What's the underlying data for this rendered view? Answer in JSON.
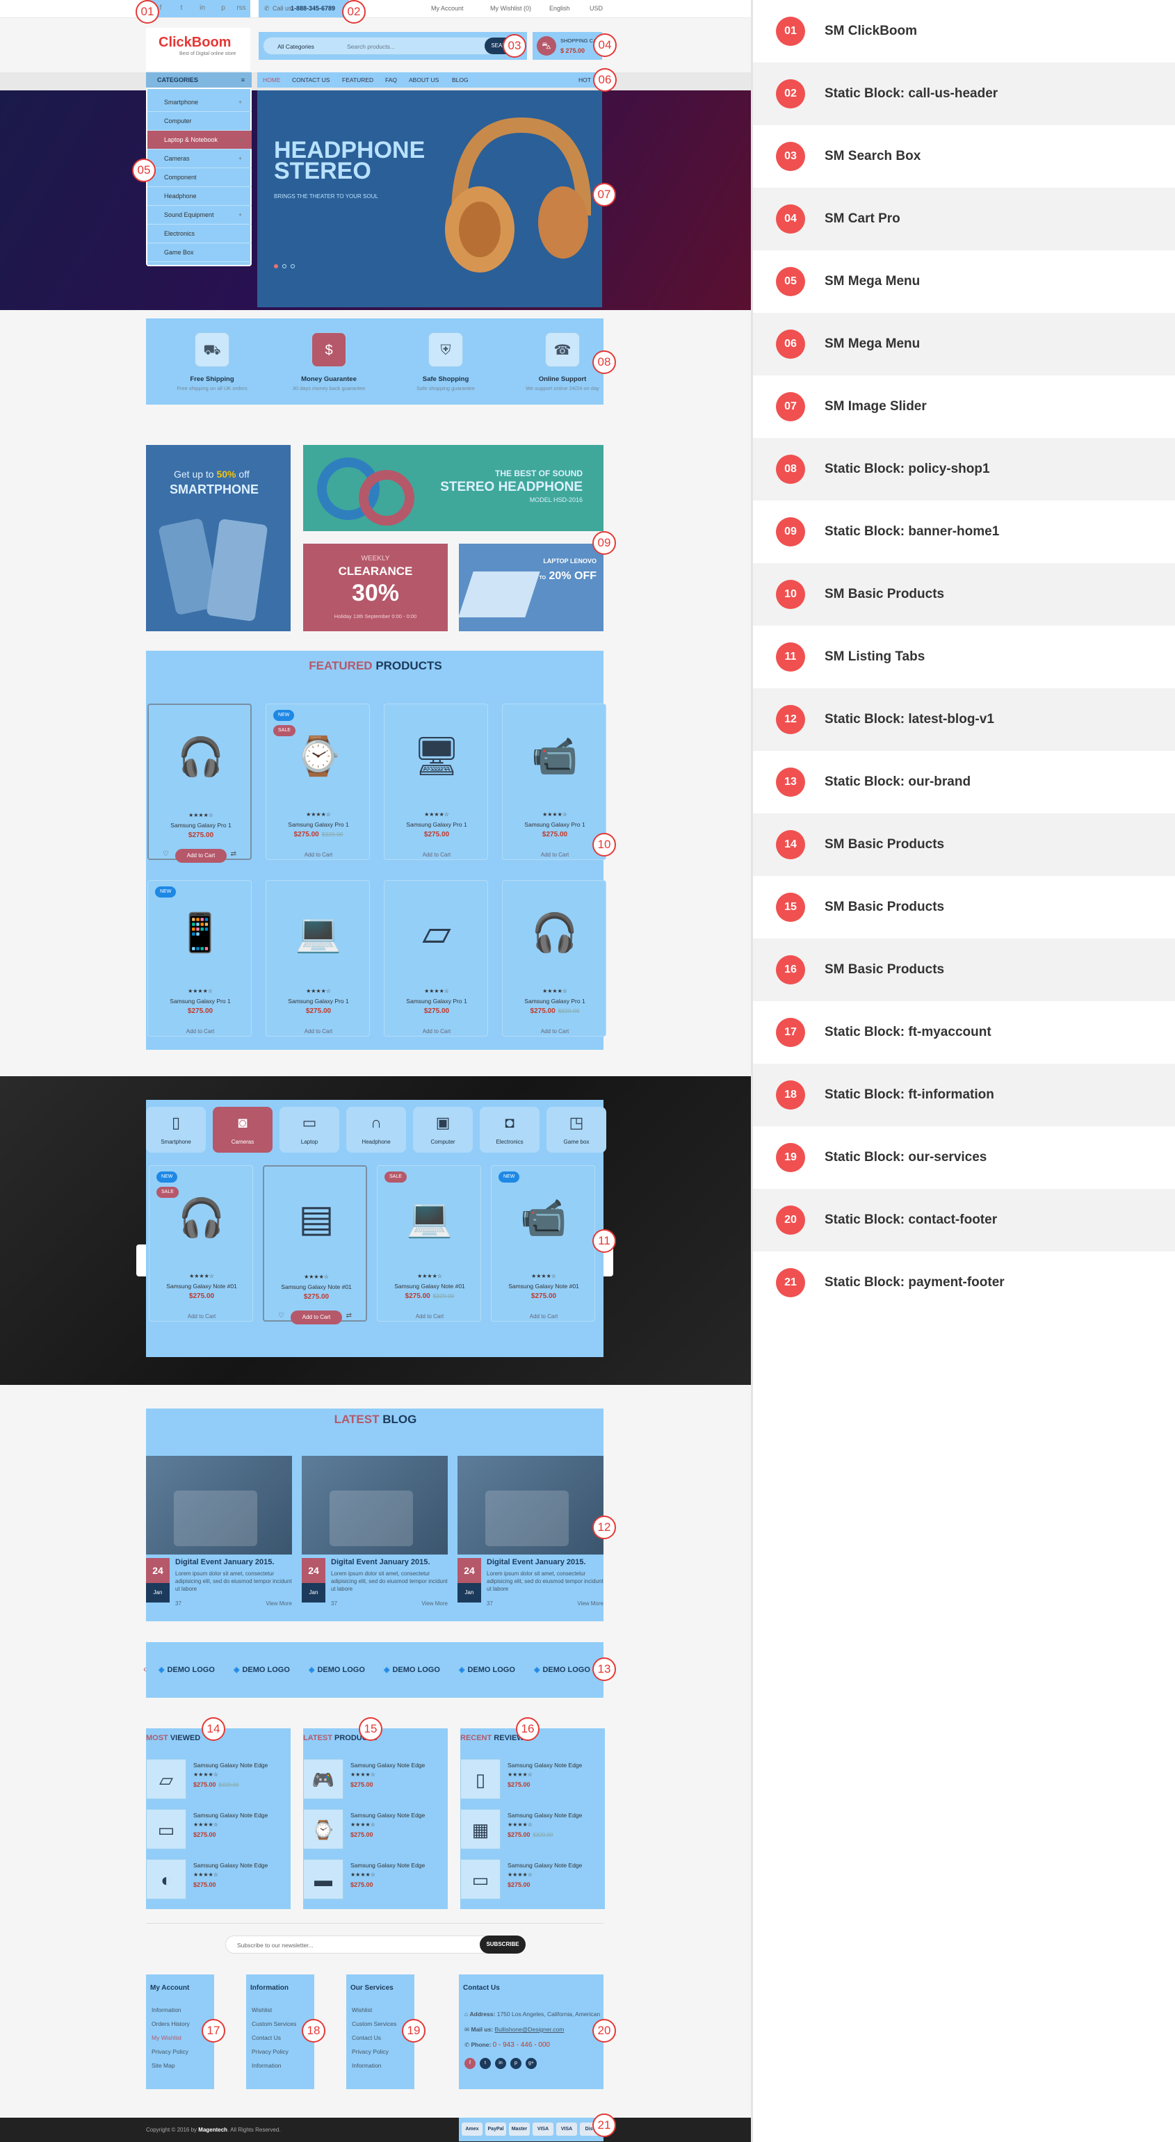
{
  "header": {
    "social_icons": [
      "f",
      "t",
      "in",
      "p",
      "rss"
    ],
    "call_label": "Call us:",
    "phone": "1-888-345-6789",
    "my_account": "My Account",
    "wishlist": "My Wishlist (0)",
    "language": "English",
    "currency": "USD",
    "logo_name": "ClickBoom",
    "logo_tagline": "Best of Digital online store",
    "search_category": "All Categories",
    "search_placeholder": "Search products...",
    "search_button": "SEARCH",
    "cart_label": "SHOPPING CART",
    "cart_total": "$ 275.00",
    "hot_label": "HOT"
  },
  "categories": {
    "title": "CATEGORIES",
    "items": [
      {
        "label": "Smartphone",
        "arrow": "+"
      },
      {
        "label": "Computer",
        "arrow": ""
      },
      {
        "label": "Laptop & Notebook",
        "arrow": "+"
      },
      {
        "label": "Cameras",
        "arrow": "+"
      },
      {
        "label": "Component",
        "arrow": ""
      },
      {
        "label": "Headphone",
        "arrow": ""
      },
      {
        "label": "Sound Equipment",
        "arrow": "+"
      },
      {
        "label": "Electronics",
        "arrow": ""
      },
      {
        "label": "Game Box",
        "arrow": ""
      }
    ]
  },
  "menu": [
    "HOME",
    "CONTACT US",
    "FEATURED",
    "FAQ",
    "ABOUT US",
    "BLOG"
  ],
  "slider": {
    "title_line1": "HEADPHONE",
    "title_line2": "STEREO",
    "subtitle": "BRINGS THE THEATER TO YOUR SOUL"
  },
  "policies": [
    {
      "title": "Free Shipping",
      "sub": "Free shipping on all UK orders",
      "icon": "⛟"
    },
    {
      "title": "Money Guarantee",
      "sub": "30 days money back guarantee",
      "icon": "$"
    },
    {
      "title": "Safe Shopping",
      "sub": "Safe shopping guarantee",
      "icon": "⛨"
    },
    {
      "title": "Online Support",
      "sub": "We support online 24/24 on day",
      "icon": "☎"
    }
  ],
  "banners": {
    "b1_line1": "Get up to",
    "b1_pct": "50%",
    "b1_off": "off",
    "b1_line2": "SMARTPHONE",
    "b2_line1": "THE BEST OF SOUND",
    "b2_line2": "STEREO HEADPHONE",
    "b2_line3": "MODEL HSD-2016",
    "b3_line1": "WEEKLY",
    "b3_line2": "CLEARANCE",
    "b3_pct": "30%",
    "b3_line3": "Holiday 13th September 0:00 - 0:00",
    "b4_line1": "LAPTOP LENOVO",
    "b4_up": "UP TO",
    "b4_pct": "20% OFF"
  },
  "featured": {
    "title_a": "FEATURED",
    "title_b": "PRODUCTS",
    "products": [
      {
        "name": "Samsung Galaxy Pro 1",
        "price": "$275.00",
        "old": "",
        "icon": "🎧",
        "tags": [],
        "btn": "Add to Cart",
        "active": true
      },
      {
        "name": "Samsung Galaxy Pro 1",
        "price": "$275.00",
        "old": "$329.00",
        "icon": "⌚",
        "tags": [
          "NEW",
          "SALE"
        ],
        "btn": "Add to Cart",
        "active": false
      },
      {
        "name": "Samsung Galaxy Pro 1",
        "price": "$275.00",
        "old": "",
        "icon": "🖥",
        "tags": [],
        "btn": "Add to Cart",
        "active": false
      },
      {
        "name": "Samsung Galaxy Pro 1",
        "price": "$275.00",
        "old": "",
        "icon": "📹",
        "tags": [],
        "btn": "Add to Cart",
        "active": false
      },
      {
        "name": "Samsung Galaxy Pro 1",
        "price": "$275.00",
        "old": "",
        "icon": "📱",
        "tags": [
          "NEW"
        ],
        "btn": "Add to Cart",
        "active": false
      },
      {
        "name": "Samsung Galaxy Pro 1",
        "price": "$275.00",
        "old": "",
        "icon": "💻",
        "tags": [],
        "btn": "Add to Cart",
        "active": false
      },
      {
        "name": "Samsung Galaxy Pro 1",
        "price": "$275.00",
        "old": "",
        "icon": "▱",
        "tags": [],
        "btn": "Add to Cart",
        "active": false
      },
      {
        "name": "Samsung Galaxy Pro 1",
        "price": "$275.00",
        "old": "$329.00",
        "icon": "🎧",
        "tags": [],
        "btn": "Add to Cart",
        "active": false
      }
    ]
  },
  "tabs": {
    "items": [
      {
        "label": "Smartphone",
        "icon": "▯"
      },
      {
        "label": "Cameras",
        "icon": "◙"
      },
      {
        "label": "Laptop",
        "icon": "▭"
      },
      {
        "label": "Headphone",
        "icon": "∩"
      },
      {
        "label": "Computer",
        "icon": "▣"
      },
      {
        "label": "Electronics",
        "icon": "◘"
      },
      {
        "label": "Game box",
        "icon": "◳"
      }
    ],
    "products": [
      {
        "name": "Samsung Galaxy Note #01",
        "price": "$275.00",
        "old": "",
        "icon": "🎧",
        "tags": [
          "NEW",
          "SALE"
        ],
        "btn": "Add to Cart",
        "active": false
      },
      {
        "name": "Samsung Galaxy Note #01",
        "price": "$275.00",
        "old": "",
        "icon": "▤",
        "tags": [],
        "btn": "Add to Cart",
        "active": true
      },
      {
        "name": "Samsung Galaxy Note #01",
        "price": "$275.00",
        "old": "$329.00",
        "icon": "💻",
        "tags": [
          "SALE"
        ],
        "btn": "Add to Cart",
        "active": false
      },
      {
        "name": "Samsung Galaxy Note #01",
        "price": "$275.00",
        "old": "",
        "icon": "📹",
        "tags": [
          "NEW"
        ],
        "btn": "Add to Cart",
        "active": false
      }
    ]
  },
  "blog": {
    "title_a": "LATEST",
    "title_b": "BLOG",
    "posts": [
      {
        "day": "24",
        "month": "Jan",
        "title": "Digital Event January 2015.",
        "excerpt": "Lorem ipsum dolor sit amet, consectetur adipisicing elit, sed do eiusmod tempor incidunt ut labore",
        "more": "View More",
        "count": "37"
      },
      {
        "day": "24",
        "month": "Jan",
        "title": "Digital Event January 2015.",
        "excerpt": "Lorem ipsum dolor sit amet, consectetur adipisicing elit, sed do eiusmod tempor incidunt ut labore",
        "more": "View More",
        "count": "37"
      },
      {
        "day": "24",
        "month": "Jan",
        "title": "Digital Event January 2015.",
        "excerpt": "Lorem ipsum dolor sit amet, consectetur adipisicing elit, sed do eiusmod tempor incidunt ut labore",
        "more": "View More",
        "count": "37"
      }
    ]
  },
  "brands": [
    "DEMO LOGO",
    "DEMO LOGO",
    "DEMO LOGO",
    "DEMO LOGO",
    "DEMO LOGO",
    "DEMO LOGO"
  ],
  "lists": [
    {
      "title_a": "MOST",
      "title_b": "VIEWED",
      "items": [
        {
          "name": "Samsung Galaxy Note Edge",
          "price": "$275.00",
          "old": "$329.00",
          "icon": "▱"
        },
        {
          "name": "Samsung Galaxy Note Edge",
          "price": "$275.00",
          "old": "",
          "icon": "▭"
        },
        {
          "name": "Samsung Galaxy Note Edge",
          "price": "$275.00",
          "old": "",
          "icon": "◐"
        }
      ]
    },
    {
      "title_a": "LATEST",
      "title_b": "PRODUCTS",
      "items": [
        {
          "name": "Samsung Galaxy Note Edge",
          "price": "$275.00",
          "old": "",
          "icon": "🎮"
        },
        {
          "name": "Samsung Galaxy Note Edge",
          "price": "$275.00",
          "old": "",
          "icon": "⌚"
        },
        {
          "name": "Samsung Galaxy Note Edge",
          "price": "$275.00",
          "old": "",
          "icon": "▬"
        }
      ]
    },
    {
      "title_a": "RECENT",
      "title_b": "REVIEWS",
      "items": [
        {
          "name": "Samsung Galaxy Note Edge",
          "price": "$275.00",
          "old": "",
          "icon": "▯"
        },
        {
          "name": "Samsung Galaxy Note Edge",
          "price": "$275.00",
          "old": "$329.00",
          "icon": "▦"
        },
        {
          "name": "Samsung Galaxy Note Edge",
          "price": "$275.00",
          "old": "",
          "icon": "▭"
        }
      ]
    }
  ],
  "newsletter": {
    "placeholder": "Subscribe to our newsletter...",
    "button": "SUBSCRIBE"
  },
  "footer": {
    "my_account": {
      "title": "My Account",
      "links": [
        "Information",
        "Orders History",
        "My Wishlist",
        "Privacy Policy",
        "Site Map"
      ]
    },
    "information": {
      "title": "Information",
      "links": [
        "Wishlist",
        "Custom Services",
        "Contact Us",
        "Privacy Policy",
        "Information"
      ]
    },
    "services": {
      "title": "Our Services",
      "links": [
        "Wishlist",
        "Custom Services",
        "Contact Us",
        "Privacy Policy",
        "Information"
      ]
    },
    "contact": {
      "title": "Contact Us",
      "address_label": "Address:",
      "address": "1750 Los Angeles, California, American",
      "mail_label": "Mail us:",
      "mail": "Bullishone@Designer.com",
      "phone_label": "Phone:",
      "phone": "0 - 943 - 446 - 000",
      "socials": [
        "f",
        "t",
        "in",
        "p",
        "g+"
      ]
    },
    "copyright_prefix": "Copyright © 2016 by ",
    "copyright_brand": "Magentech",
    "copyright_suffix": ". All Rights Reserved.",
    "payments": [
      "Amex",
      "PayPal",
      "Master",
      "VISA",
      "VISA",
      "Disc"
    ]
  },
  "legend": [
    {
      "num": "01",
      "label": "SM ClickBoom"
    },
    {
      "num": "02",
      "label": "Static Block: call-us-header"
    },
    {
      "num": "03",
      "label": "SM Search Box"
    },
    {
      "num": "04",
      "label": "SM Cart Pro"
    },
    {
      "num": "05",
      "label": "SM Mega Menu"
    },
    {
      "num": "06",
      "label": "SM Mega Menu"
    },
    {
      "num": "07",
      "label": "SM Image Slider"
    },
    {
      "num": "08",
      "label": "Static Block: policy-shop1"
    },
    {
      "num": "09",
      "label": "Static Block: banner-home1"
    },
    {
      "num": "10",
      "label": "SM Basic Products"
    },
    {
      "num": "11",
      "label": "SM Listing Tabs"
    },
    {
      "num": "12",
      "label": "Static Block: latest-blog-v1"
    },
    {
      "num": "13",
      "label": "Static Block: our-brand"
    },
    {
      "num": "14",
      "label": "SM Basic Products"
    },
    {
      "num": "15",
      "label": "SM Basic Products"
    },
    {
      "num": "16",
      "label": "SM Basic Products"
    },
    {
      "num": "17",
      "label": "Static Block: ft-myaccount"
    },
    {
      "num": "18",
      "label": "Static Block: ft-information"
    },
    {
      "num": "19",
      "label": "Static Block: our-services"
    },
    {
      "num": "20",
      "label": "Static Block: contact-footer"
    },
    {
      "num": "21",
      "label": "Static Block: payment-footer"
    }
  ],
  "badges": [
    "01",
    "02",
    "03",
    "04",
    "05",
    "06",
    "07",
    "08",
    "09",
    "10",
    "11",
    "12",
    "13",
    "14",
    "15",
    "16",
    "17",
    "18",
    "19",
    "20",
    "21"
  ],
  "colors": {
    "accent": "#b5586a",
    "highlight": "#91cdf8",
    "legend": "#f05050",
    "dark": "#1b3a5c"
  }
}
